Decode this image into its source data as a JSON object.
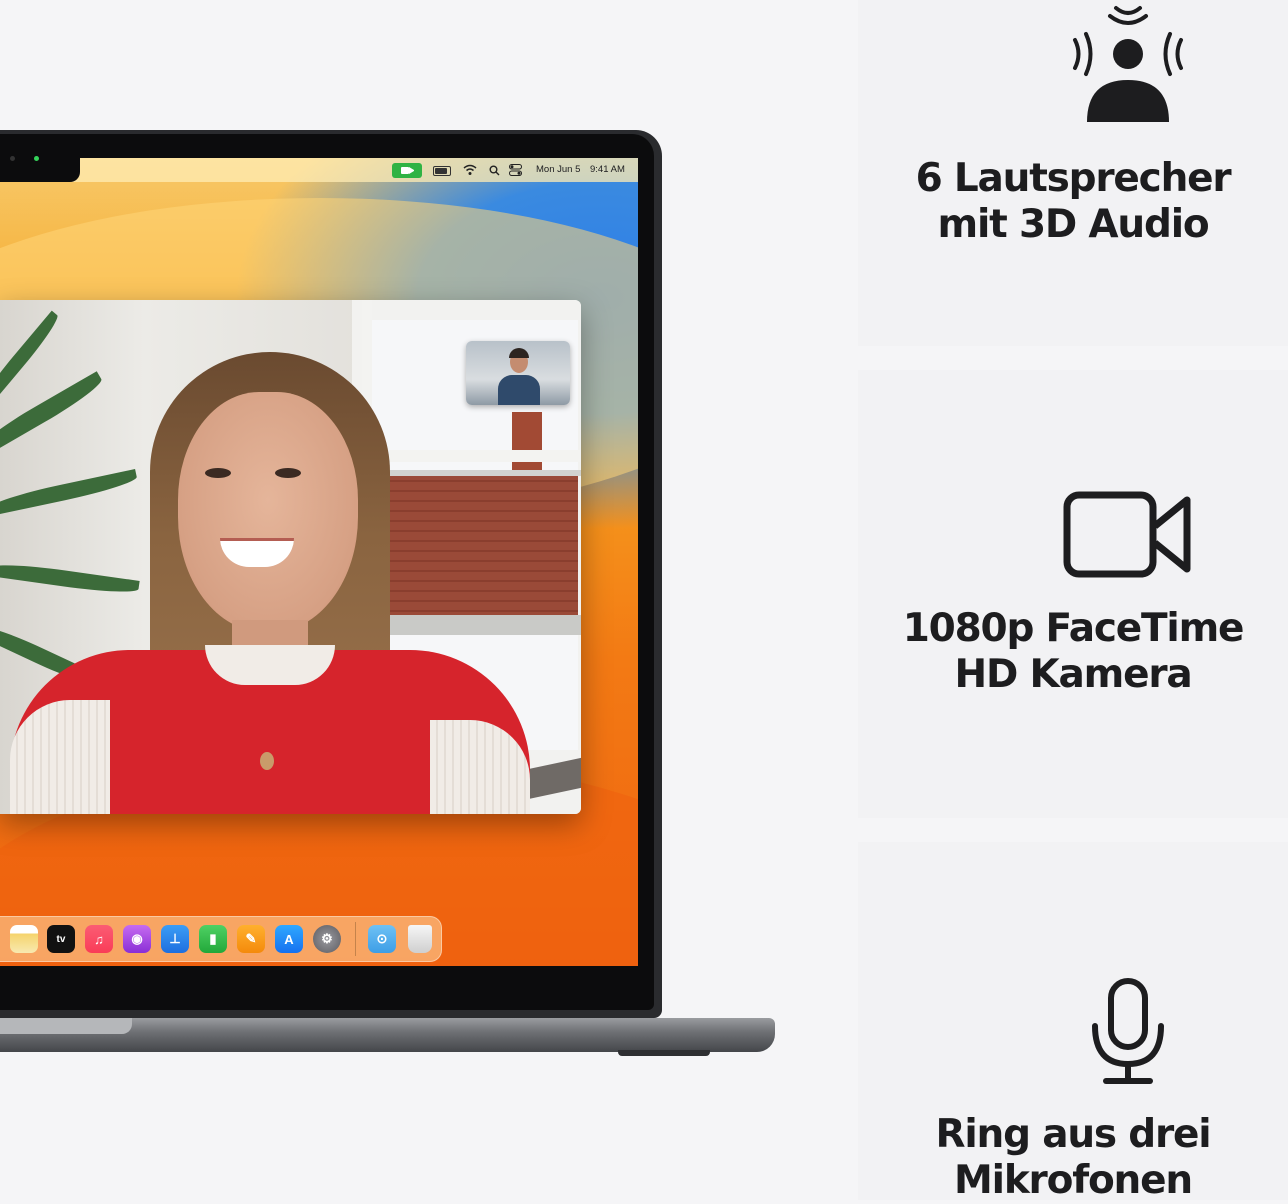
{
  "menubar": {
    "date": "Mon Jun 5",
    "time": "9:41 AM"
  },
  "dock": {
    "tv_label": "tv",
    "icons": [
      "notes-icon",
      "apple-tv-icon",
      "music-icon",
      "podcasts-icon",
      "keynote-icon",
      "numbers-icon",
      "pages-icon",
      "app-store-icon",
      "system-settings-icon",
      "downloads-folder-icon",
      "trash-icon"
    ]
  },
  "features": [
    {
      "icon": "spatial-audio-person-icon",
      "line1": "6 Lautsprecher",
      "line2": "mit 3D Audio"
    },
    {
      "icon": "video-camera-icon",
      "line1": "1080p FaceTime",
      "line2": "HD Kamera"
    },
    {
      "icon": "microphone-icon",
      "line1": "Ring aus drei",
      "line2": "Mikrofonen"
    }
  ],
  "colors": {
    "background": "#f5f5f7",
    "feature_card": "#f2f2f4",
    "text": "#1d1d1f",
    "facetime_green": "#2fb344",
    "laptop_space_gray": "#2a2b2e"
  }
}
